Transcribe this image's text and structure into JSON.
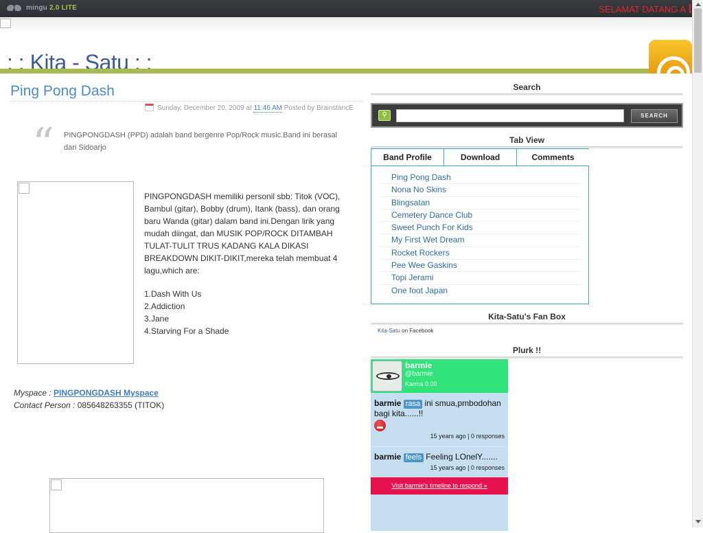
{
  "topbar": {
    "brand": "mingu",
    "version": "2.0",
    "edition": "LITE",
    "welcome": "SELAMAT DATANG A"
  },
  "header": {
    "site_title": ": : Kita - Satu : :"
  },
  "post": {
    "title": "Ping Pong Dash",
    "date": "Sunday, December 20, 2009",
    "at_label": "at",
    "time": "11:46 AM",
    "posted_by_label": "Posted by",
    "author": "BrainstancE",
    "quote_mark": "“",
    "quote": "PINGPONGDASH (PPD) adalah band bergenre Pop/Rock music.Band ini berasal dari Sidoarjo",
    "body": "PINGPONGDASH memiliki personil sbb: Titok (VOC), Bambul (gitar), Bobby (drum), Itank (bass), dan orang baru Wanda (gitar) dalam band ini.Dengan lirik yang mudah diingat, dan MUSIK POP/ROCK DITAMBAH TULAT-TULIT TRUS KADANG KALA DIKASI BREAKDOWN DIKIT-DIKIT,mereka telah membuat 4 lagu,which are:",
    "songs": [
      "1.Dash With Us",
      "2.Addiction",
      "3.Jane",
      "4.Starving For a Shade"
    ],
    "myspace_label": "Myspace :",
    "myspace_link": "PINGPONGDASH Myspace",
    "contact_label": "Contact Person :",
    "contact_value": "085648263355 (TITOK)"
  },
  "sidebar": {
    "search": {
      "title": "Search",
      "go_icon": "magnifier-icon",
      "placeholder": "",
      "button": "SEARCH"
    },
    "tabview": {
      "title": "Tab View",
      "tabs": [
        "Band Profile",
        "Download",
        "Comments"
      ],
      "items": [
        "Ping Pong Dash",
        "Nona No Skins",
        "Blingsatan",
        "Cemetery Dance Club",
        "Sweet Punch For Kids",
        "My First Wet Dream",
        "Rocket Rockers",
        "Pee Wee Gaskins",
        "Topi Jerami",
        "One foot Japan"
      ]
    },
    "fanbox": {
      "title": "Kita-Satu's Fan Box",
      "link": "Kita-Satu",
      "suffix": "on Facebook"
    },
    "plurk": {
      "title": "Plurk !!",
      "name": "barmie",
      "handle": "@barmie",
      "karma": "Karma 0.00",
      "posts": [
        {
          "user": "barmie",
          "qualifier": "rasa",
          "text": "ini smua,pmbodohan bagi kita......!!",
          "meta": "15 years ago | 0 responses"
        },
        {
          "user": "barmie",
          "qualifier": "feels",
          "text": "Feeling LOnelY.......",
          "meta": "15 years ago | 0 responses"
        }
      ],
      "respond": "Visit barmie's timeline to respond »"
    }
  },
  "colors": {
    "topbar": "#2f3237",
    "accent_green": "#a8bb52",
    "title_blue": "#3c5a98",
    "link_blue": "#2d6ea8",
    "welcome_red": "#e3262b",
    "plurk_green": "#32e27a",
    "plurk_pink": "#e6124e"
  }
}
